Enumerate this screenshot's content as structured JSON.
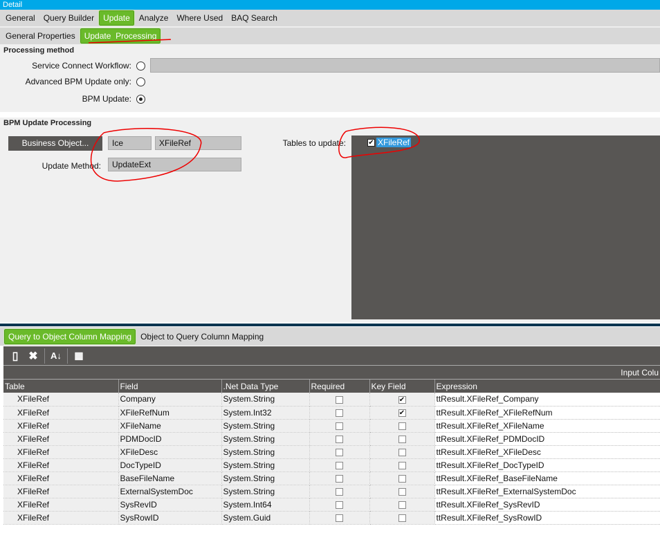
{
  "window": {
    "title": "Detail"
  },
  "main_tabs": [
    {
      "label": "General"
    },
    {
      "label": "Query Builder"
    },
    {
      "label": "Update"
    },
    {
      "label": "Analyze"
    },
    {
      "label": "Where Used"
    },
    {
      "label": "BAQ Search"
    }
  ],
  "sub_tabs": [
    {
      "label": "General Properties"
    },
    {
      "label": "Update  Processing"
    }
  ],
  "processing": {
    "header": "Processing method",
    "service_connect": "Service Connect Workflow:",
    "advanced_bpm": "Advanced BPM Update only:",
    "bpm_update": "BPM Update:",
    "selected": "BPM Update"
  },
  "bpm": {
    "header": "BPM Update Processing",
    "business_object_button": "Business Object...",
    "bo_system": "Ice",
    "bo_name": "XFileRef",
    "update_method_label": "Update Method:",
    "update_method": "UpdateExt",
    "tables_label": "Tables to update:",
    "tables": [
      {
        "name": "XFileRef",
        "checked": true
      }
    ]
  },
  "mapping_tabs": [
    {
      "label": "Query to Object Column Mapping"
    },
    {
      "label": "Object to Query Column Mapping"
    }
  ],
  "grid": {
    "band_label": "Input Colu",
    "columns": [
      "Table",
      "Field",
      ".Net Data Type",
      "Required",
      "Key Field",
      "Expression"
    ],
    "rows": [
      {
        "table": "XFileRef",
        "field": "Company",
        "type": "System.String",
        "required": false,
        "key": true,
        "expr": "ttResult.XFileRef_Company"
      },
      {
        "table": "XFileRef",
        "field": "XFileRefNum",
        "type": "System.Int32",
        "required": false,
        "key": true,
        "expr": "ttResult.XFileRef_XFileRefNum"
      },
      {
        "table": "XFileRef",
        "field": "XFileName",
        "type": "System.String",
        "required": false,
        "key": false,
        "expr": "ttResult.XFileRef_XFileName"
      },
      {
        "table": "XFileRef",
        "field": "PDMDocID",
        "type": "System.String",
        "required": false,
        "key": false,
        "expr": "ttResult.XFileRef_PDMDocID"
      },
      {
        "table": "XFileRef",
        "field": "XFileDesc",
        "type": "System.String",
        "required": false,
        "key": false,
        "expr": "ttResult.XFileRef_XFileDesc"
      },
      {
        "table": "XFileRef",
        "field": "DocTypeID",
        "type": "System.String",
        "required": false,
        "key": false,
        "expr": "ttResult.XFileRef_DocTypeID"
      },
      {
        "table": "XFileRef",
        "field": "BaseFileName",
        "type": "System.String",
        "required": false,
        "key": false,
        "expr": "ttResult.XFileRef_BaseFileName"
      },
      {
        "table": "XFileRef",
        "field": "ExternalSystemDoc",
        "type": "System.String",
        "required": false,
        "key": false,
        "expr": "ttResult.XFileRef_ExternalSystemDoc"
      },
      {
        "table": "XFileRef",
        "field": "SysRevID",
        "type": "System.Int64",
        "required": false,
        "key": false,
        "expr": "ttResult.XFileRef_SysRevID"
      },
      {
        "table": "XFileRef",
        "field": "SysRowID",
        "type": "System.Guid",
        "required": false,
        "key": false,
        "expr": "ttResult.XFileRef_SysRowID"
      }
    ]
  }
}
